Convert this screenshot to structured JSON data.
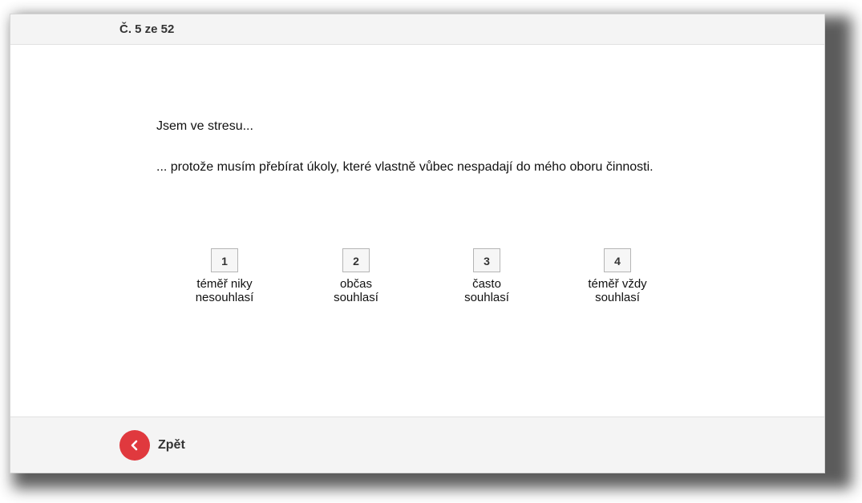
{
  "header": {
    "counter": "Č. 5 ze 52"
  },
  "question": {
    "title": "Jsem ve stresu...",
    "text": "... protože musím přebírat úkoly, které vlastně vůbec nespadají do mého oboru činnosti."
  },
  "options": [
    {
      "number": "1",
      "label": "téměř niky nesouhlasí"
    },
    {
      "number": "2",
      "label": "občas souhlasí"
    },
    {
      "number": "3",
      "label": "často souhlasí"
    },
    {
      "number": "4",
      "label": "téměř vždy souhlasí"
    }
  ],
  "footer": {
    "back_label": "Zpět",
    "back_icon": "chevron-left-icon",
    "accent_color": "#e0393e"
  }
}
